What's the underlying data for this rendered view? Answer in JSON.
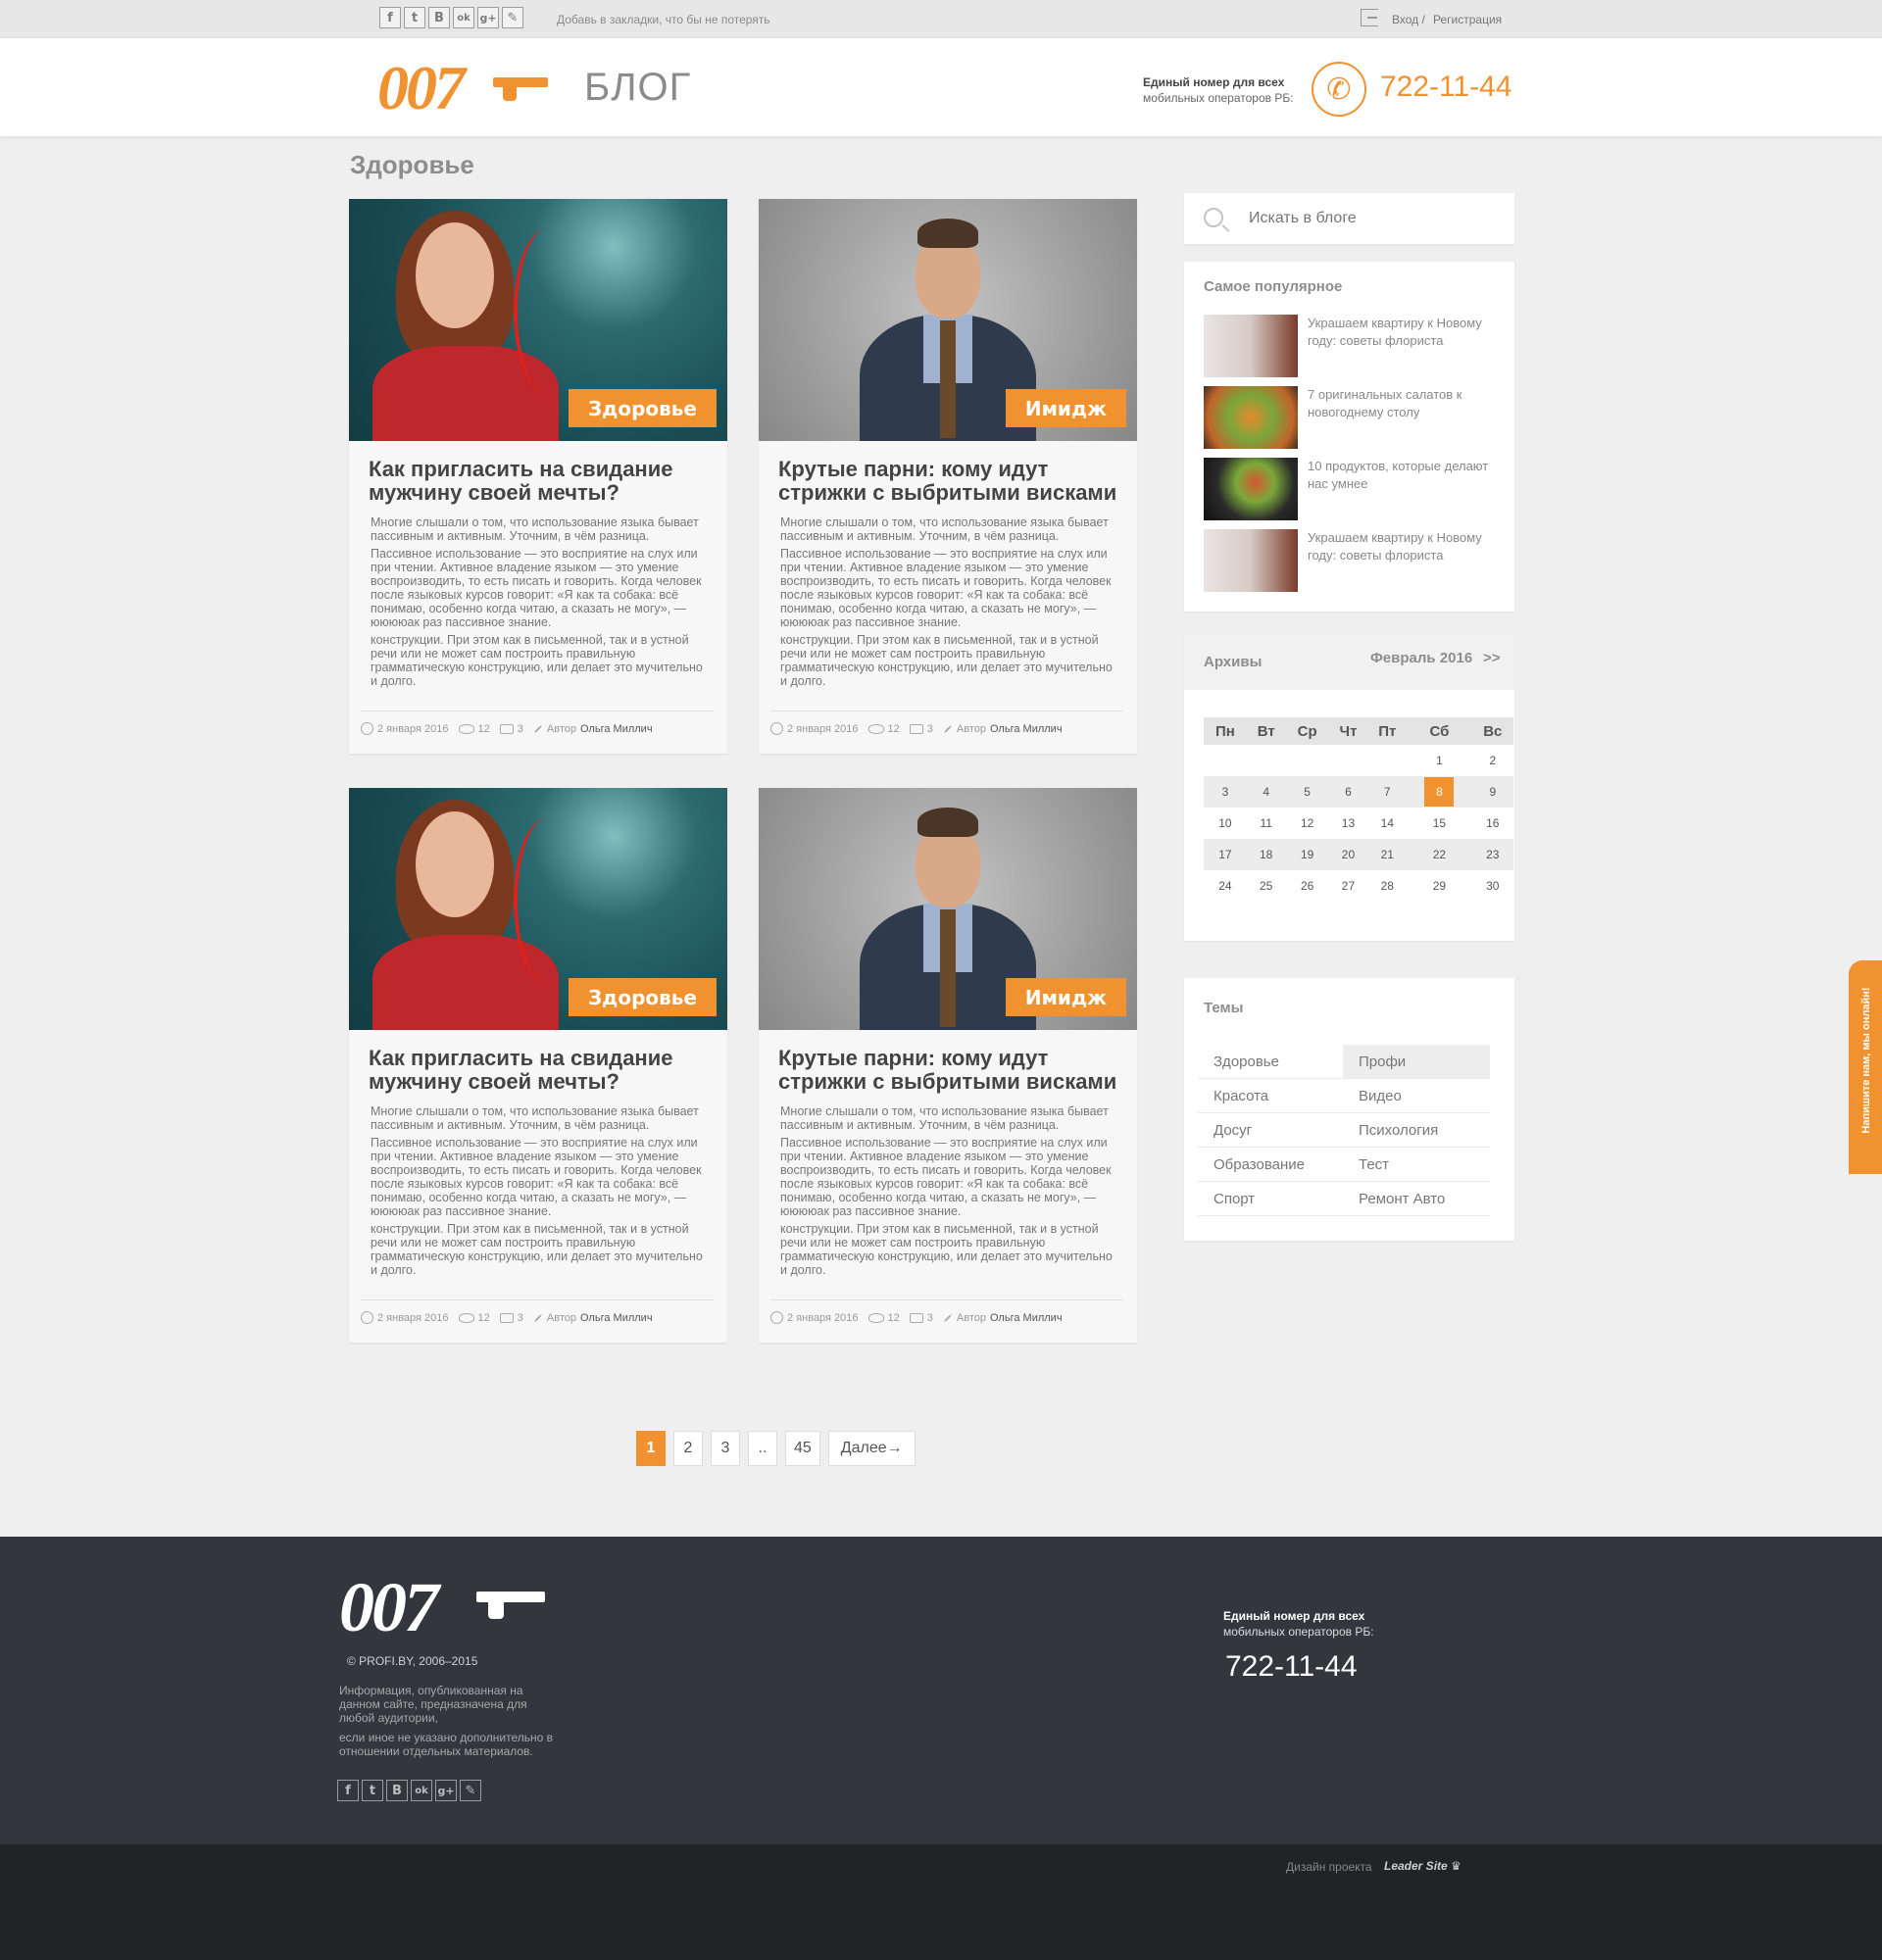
{
  "topbar": {
    "bookmark_text": "Добавь в закладки, что бы не потерять",
    "login": "Вход /",
    "register": "Регистрация",
    "social": [
      "f",
      "t",
      "B",
      "ok",
      "g+",
      "✎"
    ]
  },
  "header": {
    "logo": "007",
    "blog_label": "БЛОГ",
    "note_line1": "Единый номер для всех",
    "note_line2": "мобильных операторов РБ:",
    "phone": "722-11-44"
  },
  "section_title": "Здоровье",
  "cards": [
    {
      "tag": "Здоровье",
      "title": "Как пригласить на свидание мужчину своей мечты?",
      "p1": "Многие слышали о том, что использование языка бывает пассивным и активным. Уточним, в чём разница.",
      "p2": "Пассивное использование — это восприятие на слух или при чтении. Активное владение языком — это умение воспроизводить, то есть писать и говорить. Когда человек после языковых курсов говорит: «Я как та собака: всё понимаю, особенно когда читаю, а сказать не могу», — ююююак раз пассивное знание.",
      "p3": "конструкции. При этом как в письменной, так и в устной речи или не может сам построить правильную грамматическую конструкцию, или делает это мучительно и долго.",
      "date": "2 января 2016",
      "views": "12",
      "comments": "3",
      "author_label": "Автор",
      "author": "Ольга Миллич"
    },
    {
      "tag": "Имидж",
      "title": "Крутые парни: кому идут стрижки с выбритыми висками",
      "p1": "Многие слышали о том, что использование языка бывает пассивным и активным. Уточним, в чём разница.",
      "p2": "Пассивное использование — это восприятие на слух или при чтении. Активное владение языком — это умение воспроизводить, то есть писать и говорить. Когда человек после языковых курсов говорит: «Я как та собака: всё понимаю, особенно когда читаю, а сказать не могу», — ююююак раз пассивное знание.",
      "p3": "конструкции. При этом как в письменной, так и в устной речи или не может сам построить правильную грамматическую конструкцию, или делает это мучительно и долго.",
      "date": "2 января 2016",
      "views": "12",
      "comments": "3",
      "author_label": "Автор",
      "author": "Ольга Миллич"
    },
    {
      "tag": "Здоровье",
      "title": "Как пригласить на свидание мужчину своей мечты?",
      "p1": "Многие слышали о том, что использование языка бывает пассивным и активным. Уточним, в чём разница.",
      "p2": "Пассивное использование — это восприятие на слух или при чтении. Активное владение языком — это умение воспроизводить, то есть писать и говорить. Когда человек после языковых курсов говорит: «Я как та собака: всё понимаю, особенно когда читаю, а сказать не могу», — ююююак раз пассивное знание.",
      "p3": "конструкции. При этом как в письменной, так и в устной речи или не может сам построить правильную грамматическую конструкцию, или делает это мучительно и долго.",
      "date": "2 января 2016",
      "views": "12",
      "comments": "3",
      "author_label": "Автор",
      "author": "Ольга Миллич"
    },
    {
      "tag": "Имидж",
      "title": "Крутые парни: кому идут стрижки с выбритыми висками",
      "p1": "Многие слышали о том, что использование языка бывает пассивным и активным. Уточним, в чём разница.",
      "p2": "Пассивное использование — это восприятие на слух или при чтении. Активное владение языком — это умение воспроизводить, то есть писать и говорить. Когда человек после языковых курсов говорит: «Я как та собака: всё понимаю, особенно когда читаю, а сказать не могу», — ююююак раз пассивное знание.",
      "p3": "конструкции. При этом как в письменной, так и в устной речи или не может сам построить правильную грамматическую конструкцию, или делает это мучительно и долго.",
      "date": "2 января 2016",
      "views": "12",
      "comments": "3",
      "author_label": "Автор",
      "author": "Ольга Миллич"
    }
  ],
  "sidebar": {
    "search_placeholder": "Искать в блоге",
    "popular_title": "Самое популярное",
    "popular": [
      "Украшаем квартиру к Новому году: советы флориста",
      "7 оригинальных салатов к новогоднему столу",
      "10 продуктов, которые делают нас умнее",
      "Украшаем квартиру к Новому году: советы флориста"
    ],
    "archive_title": "Архивы",
    "archive_month": "Февраль 2016",
    "archive_next": ">>",
    "weekdays": [
      "Пн",
      "Вт",
      "Ср",
      "Чт",
      "Пт",
      "Сб",
      "Вс"
    ],
    "weeks": [
      [
        "",
        "",
        "",
        "",
        "",
        "1",
        "2"
      ],
      [
        "3",
        "4",
        "5",
        "6",
        "7",
        "8",
        "9"
      ],
      [
        "10",
        "11",
        "12",
        "13",
        "14",
        "15",
        "16"
      ],
      [
        "17",
        "18",
        "19",
        "20",
        "21",
        "22",
        "23"
      ],
      [
        "24",
        "25",
        "26",
        "27",
        "28",
        "29",
        "30"
      ]
    ],
    "today": "8",
    "themes_title": "Темы",
    "themes_left": [
      "Здоровье",
      "Красота",
      "Досуг",
      "Образование",
      "Спорт"
    ],
    "themes_right": [
      "Профи",
      "Видео",
      "Психология",
      "Тест",
      "Ремонт Авто"
    ]
  },
  "pagination": {
    "pages": [
      "1",
      "2",
      "3",
      "..",
      "45"
    ],
    "next": "Далее→",
    "current": "1"
  },
  "side_tab": "Напишите нам, мы онлайн!",
  "footer": {
    "logo": "007",
    "copyright": "© PROFI.BY, 2006–2015",
    "info1": "Информация, опубликованная на данном сайте, предназначена для любой аудитории,",
    "info2": "если иное не указано дополнительно в отношении отдельных материалов.",
    "note_line1": "Единый номер для всех",
    "note_line2": "мобильных операторов РБ:",
    "phone": "722-11-44",
    "design_label": "Дизайн проекта",
    "design_brand": "Leader Site ♛"
  },
  "colors": {
    "accent": "#f0922f",
    "footer_bg": "#33363c",
    "footer_bottom_bg": "#222326",
    "page_bg": "#efefef"
  }
}
